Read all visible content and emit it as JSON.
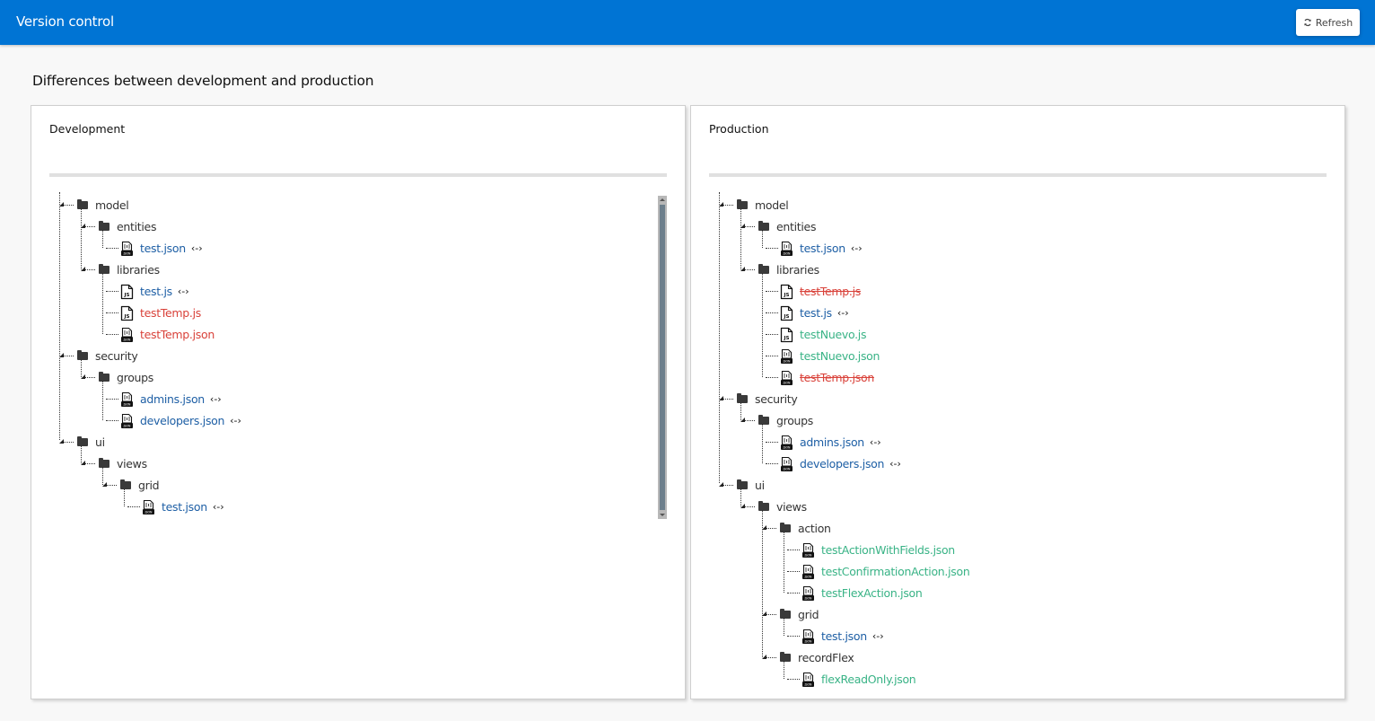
{
  "header": {
    "title": "Version control",
    "refresh_label": "Refresh",
    "refresh_icon": "refresh-icon"
  },
  "page": {
    "heading": "Differences between development and production"
  },
  "colors": {
    "topbar": "#0074d4",
    "unchanged_file": "#1e5fa5",
    "removed_file": "#d9423a",
    "added_file": "#39b386"
  },
  "development": {
    "title": "Development",
    "tree": [
      {
        "type": "folder",
        "name": "model",
        "depth": 0
      },
      {
        "type": "folder",
        "name": "entities",
        "depth": 1
      },
      {
        "type": "file",
        "name": "test.json",
        "depth": 2,
        "kind": "json",
        "status": "same",
        "diff": true
      },
      {
        "type": "folder",
        "name": "libraries",
        "depth": 1
      },
      {
        "type": "file",
        "name": "test.js",
        "depth": 2,
        "kind": "js",
        "status": "same",
        "diff": true
      },
      {
        "type": "file",
        "name": "testTemp.js",
        "depth": 2,
        "kind": "js",
        "status": "removed",
        "diff": false
      },
      {
        "type": "file",
        "name": "testTemp.json",
        "depth": 2,
        "kind": "json",
        "status": "removed",
        "diff": false
      },
      {
        "type": "folder",
        "name": "security",
        "depth": 0
      },
      {
        "type": "folder",
        "name": "groups",
        "depth": 1
      },
      {
        "type": "file",
        "name": "admins.json",
        "depth": 2,
        "kind": "json",
        "status": "same",
        "diff": true
      },
      {
        "type": "file",
        "name": "developers.json",
        "depth": 2,
        "kind": "json",
        "status": "same",
        "diff": true
      },
      {
        "type": "folder",
        "name": "ui",
        "depth": 0
      },
      {
        "type": "folder",
        "name": "views",
        "depth": 1
      },
      {
        "type": "folder",
        "name": "grid",
        "depth": 2
      },
      {
        "type": "file",
        "name": "test.json",
        "depth": 3,
        "kind": "json",
        "status": "same",
        "diff": true
      }
    ]
  },
  "production": {
    "title": "Production",
    "tree": [
      {
        "type": "folder",
        "name": "model",
        "depth": 0
      },
      {
        "type": "folder",
        "name": "entities",
        "depth": 1
      },
      {
        "type": "file",
        "name": "test.json",
        "depth": 2,
        "kind": "json",
        "status": "same",
        "diff": true
      },
      {
        "type": "folder",
        "name": "libraries",
        "depth": 1
      },
      {
        "type": "file",
        "name": "testTemp.js",
        "depth": 2,
        "kind": "js",
        "status": "deleted",
        "diff": false
      },
      {
        "type": "file",
        "name": "test.js",
        "depth": 2,
        "kind": "js",
        "status": "same",
        "diff": true
      },
      {
        "type": "file",
        "name": "testNuevo.js",
        "depth": 2,
        "kind": "js",
        "status": "added",
        "diff": false
      },
      {
        "type": "file",
        "name": "testNuevo.json",
        "depth": 2,
        "kind": "json",
        "status": "added",
        "diff": false
      },
      {
        "type": "file",
        "name": "testTemp.json",
        "depth": 2,
        "kind": "json",
        "status": "deleted",
        "diff": false
      },
      {
        "type": "folder",
        "name": "security",
        "depth": 0
      },
      {
        "type": "folder",
        "name": "groups",
        "depth": 1
      },
      {
        "type": "file",
        "name": "admins.json",
        "depth": 2,
        "kind": "json",
        "status": "same",
        "diff": true
      },
      {
        "type": "file",
        "name": "developers.json",
        "depth": 2,
        "kind": "json",
        "status": "same",
        "diff": true
      },
      {
        "type": "folder",
        "name": "ui",
        "depth": 0
      },
      {
        "type": "folder",
        "name": "views",
        "depth": 1
      },
      {
        "type": "folder",
        "name": "action",
        "depth": 2
      },
      {
        "type": "file",
        "name": "testActionWithFields.json",
        "depth": 3,
        "kind": "json",
        "status": "added",
        "diff": false
      },
      {
        "type": "file",
        "name": "testConfirmationAction.json",
        "depth": 3,
        "kind": "json",
        "status": "added",
        "diff": false
      },
      {
        "type": "file",
        "name": "testFlexAction.json",
        "depth": 3,
        "kind": "json",
        "status": "added",
        "diff": false
      },
      {
        "type": "folder",
        "name": "grid",
        "depth": 2
      },
      {
        "type": "file",
        "name": "test.json",
        "depth": 3,
        "kind": "json",
        "status": "same",
        "diff": true
      },
      {
        "type": "folder",
        "name": "recordFlex",
        "depth": 2
      },
      {
        "type": "file",
        "name": "flexReadOnly.json",
        "depth": 3,
        "kind": "json",
        "status": "added",
        "diff": false
      }
    ]
  },
  "diff_icon_glyph": "‹-›"
}
